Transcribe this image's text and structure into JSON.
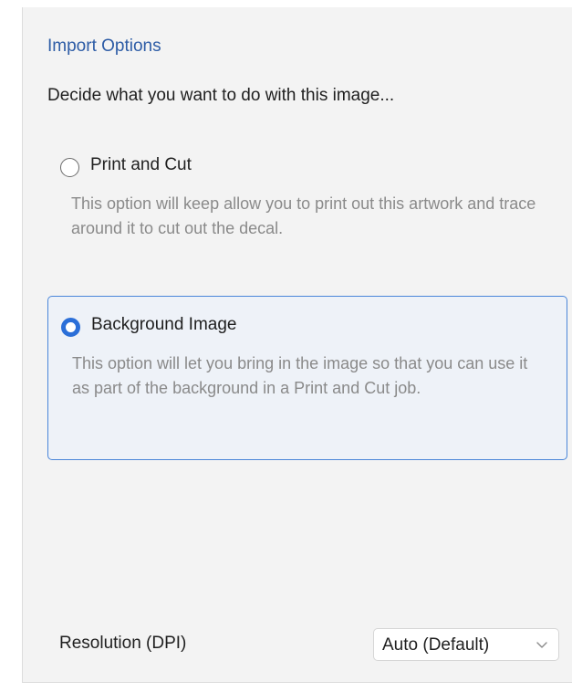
{
  "panel": {
    "title": "Import Options",
    "prompt": "Decide what you want to do with this image..."
  },
  "options": [
    {
      "label": "Print and Cut",
      "description": "This option will keep allow you to print out this artwork and trace around it to cut out the decal.",
      "selected": false,
      "icon": "radio-unselected-icon"
    },
    {
      "label": "Background Image",
      "description": "This option will let you bring in the image so that you can use it as part of the background in a Print and Cut job.",
      "selected": true,
      "icon": "radio-selected-icon"
    }
  ],
  "resolution": {
    "label": "Resolution (DPI)",
    "value": "Auto (Default)",
    "icon": "chevron-down-icon"
  },
  "colors": {
    "accent": "#2b6fd8",
    "title": "#2d5ca6",
    "selected_border": "#4a86d9",
    "panel_bg": "#f3f3f3",
    "muted_text": "#8a8a8a"
  }
}
